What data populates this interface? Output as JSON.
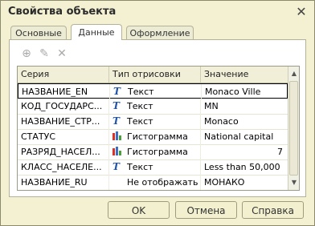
{
  "window": {
    "title": "Свойства объекта",
    "close_glyph": "✕"
  },
  "tabs": [
    {
      "label": "Основные"
    },
    {
      "label": "Данные"
    },
    {
      "label": "Оформление"
    }
  ],
  "toolbar": {
    "add_glyph": "⊕",
    "edit_glyph": "✎",
    "delete_glyph": "✕"
  },
  "grid": {
    "columns": [
      "Серия",
      "Тип отрисовки",
      "Значение"
    ],
    "rows": [
      {
        "series": "НАЗВАНИЕ_EN",
        "type": "Текст",
        "icon": "text-icon",
        "value": "Monaco Ville"
      },
      {
        "series": "КОД_ГОСУДАРС...",
        "type": "Текст",
        "icon": "text-icon",
        "value": "MN"
      },
      {
        "series": "НАЗВАНИЕ_СТР...",
        "type": "Текст",
        "icon": "text-icon",
        "value": "Monaco"
      },
      {
        "series": "СТАТУС",
        "type": "Гистограмма",
        "icon": "histogram-icon",
        "value": "National capital"
      },
      {
        "series": "РАЗРЯД_НАСЕЛ...",
        "type": "Гистограмма",
        "icon": "histogram-icon",
        "value": "7"
      },
      {
        "series": "КЛАСС_НАСЕЛЕ...",
        "type": "Текст",
        "icon": "text-icon",
        "value": "Less than 50,000"
      },
      {
        "series": "НАЗВАНИЕ_RU",
        "type": "Не отображать",
        "icon": "",
        "value": "МОНАКО"
      }
    ]
  },
  "buttons": {
    "ok": "OK",
    "cancel": "Отмена",
    "help": "Справка"
  },
  "colors": {
    "window_bg": "#f4f1d2",
    "text_icon": "#2255aa",
    "bar_red": "#d9322b",
    "bar_blue": "#3b6fc4",
    "bar_green": "#4aa03a"
  }
}
